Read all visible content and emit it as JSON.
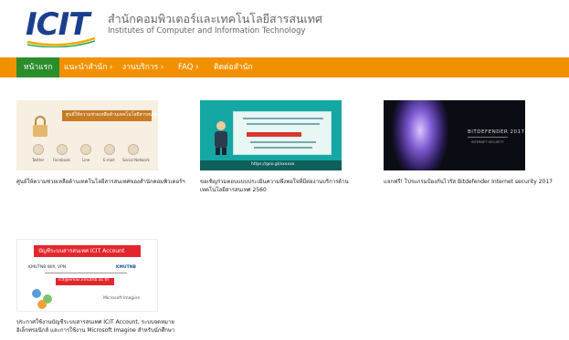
{
  "header": {
    "logo_text": "ICIT",
    "org_name_th": "สำนักคอมพิวเตอร์และเทคโนโลยีสารสนเทศ",
    "org_name_en": "Institutes of Computer and Information Technology"
  },
  "nav": {
    "items": [
      {
        "label": "หน้าแรก",
        "active": true
      },
      {
        "label": "แนะนำสำนัก ›",
        "active": false
      },
      {
        "label": "งานบริการ ›",
        "active": false
      },
      {
        "label": "FAQ ›",
        "active": false
      },
      {
        "label": "ติดต่อสำนัก",
        "active": false
      }
    ]
  },
  "cards": [
    {
      "caption": "ศูนย์ให้ความช่วยเหลือด้านเทคโนโลยีสารสนเทศของสำนักคอมพิวเตอร์ฯ",
      "thumb": {
        "banner": "ศูนย์ให้ความช่วยเหลือด้านเทคโนโลยีสารสนเทศ",
        "icons": [
          "Twitter",
          "Facebook",
          "Line",
          "E-mail",
          "Social Network"
        ]
      }
    },
    {
      "caption_line1": "ขอเชิญร่วมตอบแบบประเมินความพึงพอใจที่มีต่องานบริการด้าน",
      "caption_line2": "เทคโนโลยีสารสนเทศ 2560",
      "thumb": {
        "footer": "https://goo.gl/xxxxxx"
      }
    },
    {
      "caption": "แจกฟรี! โปรแกรมป้องกันไวรัส Bitdefender Internet security 2017",
      "thumb": {
        "title": "BITDEFENDER 2017",
        "subtitle": "INTERNET SECURITY"
      }
    },
    {
      "caption_line1": "ประกาศใช้งานบัญชีระบบสารสนเทศ ICIT Account, ระบบจดหมาย",
      "caption_line2": "อิเล็กทรอนิกส์ และการใช้งาน Microsoft Imagine สำหรับนักศึกษา",
      "thumb": {
        "header": "บัญชีระบบสารสนเทศ ICIT Account",
        "wifi": "KMUTNB Wifi, VPN",
        "ms": "KMUTNB",
        "mail": "icit@email.kmutnb.ac.th",
        "imagine": "Microsoft Imagine"
      }
    }
  ],
  "colors": {
    "nav_bg": "#f29100",
    "nav_active": "#2b8c2c",
    "logo_blue": "#1b3f8f"
  }
}
